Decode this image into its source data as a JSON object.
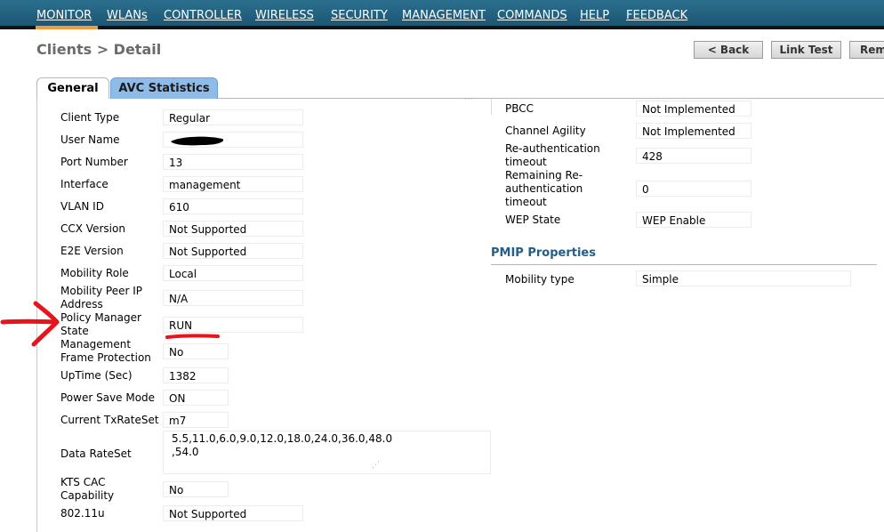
{
  "nav": {
    "items": [
      "MONITOR",
      "WLANs",
      "CONTROLLER",
      "WIRELESS",
      "SECURITY",
      "MANAGEMENT",
      "COMMANDS",
      "HELP",
      "FEEDBACK"
    ]
  },
  "header": {
    "title": "Clients > Detail",
    "back_label": "< Back",
    "link_test_label": "Link Test",
    "remove_label": "Remove"
  },
  "tabs": [
    "General",
    "AVC Statistics"
  ],
  "left_fields": [
    {
      "label": "Client Type",
      "value": "Regular"
    },
    {
      "label": "User Name",
      "value": ""
    },
    {
      "label": "Port Number",
      "value": "13"
    },
    {
      "label": "Interface",
      "value": "management"
    },
    {
      "label": "VLAN ID",
      "value": "610"
    },
    {
      "label": "CCX Version",
      "value": "Not Supported"
    },
    {
      "label": "E2E Version",
      "value": "Not Supported"
    },
    {
      "label": "Mobility Role",
      "value": "Local"
    },
    {
      "label": "Mobility Peer IP Address",
      "value": "N/A"
    },
    {
      "label": "Policy Manager State",
      "value": "RUN"
    },
    {
      "label": "Management Frame Protection",
      "value": "No"
    },
    {
      "label": "UpTime (Sec)",
      "value": "1382"
    },
    {
      "label": "Power Save Mode",
      "value": "ON"
    },
    {
      "label": "Current TxRateSet",
      "value": "m7"
    },
    {
      "label": "Data RateSet",
      "value": "5.5,11.0,6.0,9.0,12.0,18.0,24.0,36.0,48.0\n,54.0"
    },
    {
      "label": "KTS CAC Capability",
      "value": "No"
    },
    {
      "label": "802.11u",
      "value": "Not Supported"
    }
  ],
  "right_fields": [
    {
      "label": "PBCC",
      "value": "Not Implemented"
    },
    {
      "label": "Channel Agility",
      "value": "Not Implemented"
    },
    {
      "label": "Re-authentication timeout",
      "value": "428"
    },
    {
      "label": "Remaining Re-authentication timeout",
      "value": "0"
    },
    {
      "label": "WEP State",
      "value": "WEP Enable"
    }
  ],
  "pmip": {
    "title": "PMIP Properties",
    "fields": [
      {
        "label": "Mobility type",
        "value": "Simple"
      }
    ]
  },
  "annotation_color": "#e8141b",
  "nav_active_color": "#f49a3c"
}
